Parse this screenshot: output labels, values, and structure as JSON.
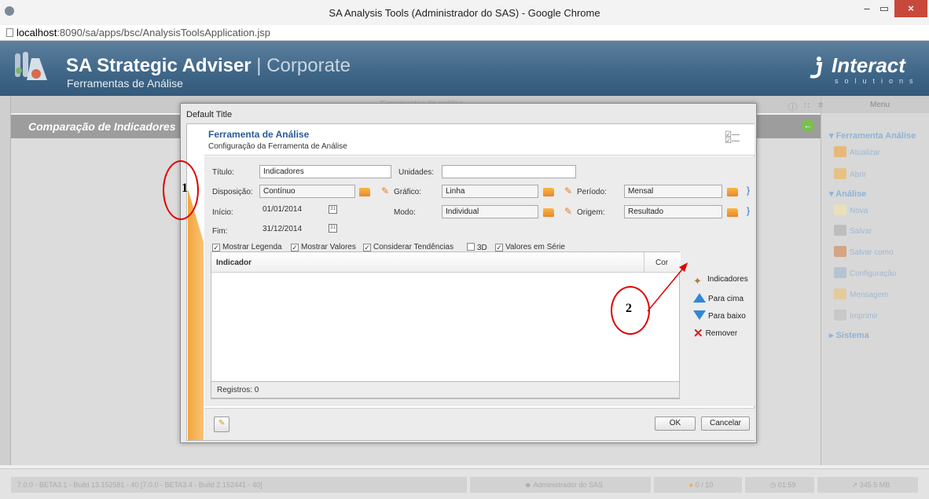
{
  "browser": {
    "window_title": "SA Analysis Tools (Administrador do SAS) - Google Chrome",
    "url_host": "localhost",
    "url_path": ":8090/sa/apps/bsc/AnalysisToolsApplication.jsp",
    "minimize": "–",
    "maximize": "▭",
    "close": "×"
  },
  "app": {
    "title_bold": "SA Strategic Adviser",
    "title_sep": " | ",
    "title_light": "Corporate",
    "subtitle": "Ferramentas de Análise",
    "brand": "Interact",
    "brand_sub": "solutions"
  },
  "center": {
    "strip_title": "Ferramentas de análise",
    "page_title": "Comparação de Indicadores"
  },
  "right_panel": {
    "menu_label": "Menu",
    "sections": [
      {
        "title": "Ferramenta Análise",
        "items": [
          "Atualizar",
          "Abrir"
        ]
      },
      {
        "title": "Análise",
        "items": [
          "Nova",
          "Salvar",
          "Salvar como",
          "Configuração",
          "Mensagem",
          "Imprimir"
        ]
      },
      {
        "title": "Sistema",
        "items": []
      }
    ]
  },
  "status_bar": {
    "build": "7.0.0 - BETA3.1 - Build 13.152581 - 40 [7.0.0 - BETA3.4 - Build 2.152441 - 40]",
    "user": "Administrador do SAS",
    "count": "0 / 10",
    "time": "01:59",
    "memory": "345.5 MB"
  },
  "dialog": {
    "window_title": "Default Title",
    "tool_title": "Ferramenta de Análise",
    "tool_subtitle": "Configuração da Ferramenta de Análise",
    "form": {
      "titulo_label": "Título:",
      "titulo_value": "Indicadores",
      "unidades_label": "Unidades:",
      "unidades_value": "",
      "disposicao_label": "Disposição:",
      "disposicao_value": "Contínuo",
      "grafico_label": "Gráfico:",
      "grafico_value": "Linha",
      "periodo_label": "Período:",
      "periodo_value": "Mensal",
      "inicio_label": "Início:",
      "inicio_value": "01/01/2014",
      "modo_label": "Modo:",
      "modo_value": "Individual",
      "origem_label": "Origem:",
      "origem_value": "Resultado",
      "fim_label": "Fim:",
      "fim_value": "31/12/2014"
    },
    "checkboxes": [
      {
        "label": "Mostrar Legenda",
        "checked": true
      },
      {
        "label": "Mostrar Valores",
        "checked": true
      },
      {
        "label": "Considerar Tendências",
        "checked": true
      },
      {
        "label": "3D",
        "checked": false
      },
      {
        "label": "Valores em Série",
        "checked": true
      }
    ],
    "table": {
      "col_indicador": "Indicador",
      "col_cor": "Cor",
      "rows": [],
      "registros": "Registros: 0"
    },
    "side_buttons": {
      "indicadores": "Indicadores",
      "para_cima": "Para cima",
      "para_baixo": "Para baixo",
      "remover": "Remover"
    },
    "ok": "OK",
    "cancelar": "Cancelar"
  },
  "annotations": {
    "one": "1",
    "two": "2"
  },
  "colors": {
    "header_blue": "#3f6687",
    "title_blue": "#2a5a96",
    "accent_orange": "#f4a53c",
    "annotation_red": "#e00000"
  }
}
